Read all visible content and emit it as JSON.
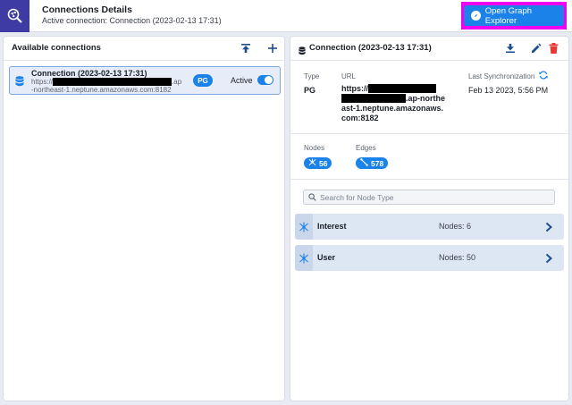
{
  "header": {
    "title": "Connections Details",
    "subtitle": "Active connection: Connection (2023-02-13 17:31)",
    "open_button_label": "Open Graph Explorer",
    "logo_icon": "graph-search-icon",
    "highlight_color": "#f000f0"
  },
  "left_panel": {
    "title": "Available connections",
    "connection": {
      "name": "Connection (2023-02-13 17:31)",
      "url_prefix": "https://",
      "url_line1_suffix": ".ap",
      "url_line2": "-northeast-1.neptune.amazonaws.com:8182",
      "type_badge": "PG",
      "status_label": "Active",
      "active": true
    }
  },
  "right_panel": {
    "title": "Connection (2023-02-13 17:31)",
    "type_label": "Type",
    "type_value": "PG",
    "url_label": "URL",
    "url_prefix": "https://",
    "url_line2_suffix": ".ap-northe",
    "url_line3": "ast-1.neptune.amazonaws.",
    "url_line4": "com:8182",
    "sync_label": "Last Synchronization",
    "sync_value": "Feb 13 2023, 5:56 PM",
    "nodes_label": "Nodes",
    "nodes_count": "56",
    "edges_label": "Edges",
    "edges_count": "578",
    "search_placeholder": "Search for Node Type",
    "node_types": [
      {
        "name": "Interest",
        "count_text": "Nodes: 6"
      },
      {
        "name": "User",
        "count_text": "Nodes: 50"
      }
    ]
  },
  "colors": {
    "accent": "#1a82e8",
    "logo_bg": "#3e3ba5",
    "delete": "#e53935"
  }
}
